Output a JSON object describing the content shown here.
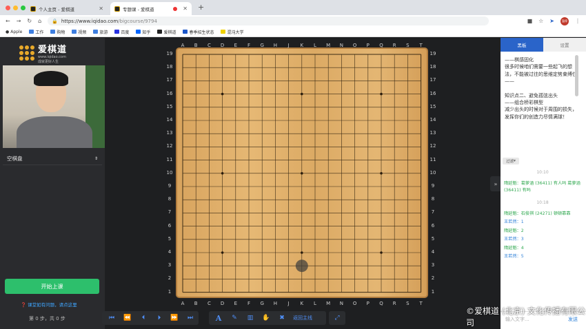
{
  "browser": {
    "tabs": [
      {
        "title": "个人主页 - 爱棋道",
        "active": false
      },
      {
        "title": "专题课 - 爱棋道",
        "active": true
      }
    ],
    "new_tab": "+",
    "url_prefix": "https://www.iqidao.com",
    "url_path": "/bigcourse/9794",
    "bookmarks": [
      "Apple",
      "工作",
      "购物",
      "视频",
      "旅游",
      "百度",
      "知乎",
      "爱棋道",
      "春季招生状态",
      "混沌大学"
    ],
    "profile_badge": "暂停"
  },
  "left": {
    "logo_title": "爱棋道",
    "logo_sub": "www.iqidao.com",
    "logo_slogan": "成就更好人生",
    "board_select": "空棋盘",
    "start_button": "开始上课",
    "help_tip": "课堂如有问题，请点这里",
    "step_info": "第 0 步，共 0 步"
  },
  "board": {
    "cols": [
      "A",
      "B",
      "C",
      "D",
      "E",
      "F",
      "G",
      "H",
      "J",
      "K",
      "L",
      "M",
      "N",
      "O",
      "P",
      "Q",
      "R",
      "S",
      "T"
    ],
    "rows": [
      "19",
      "18",
      "17",
      "16",
      "15",
      "14",
      "13",
      "12",
      "11",
      "10",
      "9",
      "8",
      "7",
      "6",
      "5",
      "4",
      "3",
      "2",
      "1"
    ],
    "star_points": [
      [
        3,
        3
      ],
      [
        9,
        3
      ],
      [
        15,
        3
      ],
      [
        3,
        9
      ],
      [
        9,
        9
      ],
      [
        15,
        9
      ],
      [
        3,
        15
      ],
      [
        9,
        15
      ],
      [
        15,
        15
      ]
    ],
    "cursor_stone": {
      "col": "K",
      "row": "3"
    }
  },
  "toolbar": {
    "nav_icons": [
      "first-icon",
      "prev5-icon",
      "prev-icon",
      "next-icon",
      "next5-icon",
      "last-icon"
    ],
    "tool_icons": [
      "text-icon",
      "pen-icon",
      "chart-icon",
      "hand-icon",
      "clear-icon"
    ],
    "back_main": "返回主线"
  },
  "right": {
    "tabs": [
      "黑板",
      "设置"
    ],
    "notes": [
      "——棋感固化",
      "很多时候咱们需要一些起飞的想法，不能被过往的思维定势束缚住——",
      "",
      "知识点二、避免孤弦出头",
      "——组合桥彩棋型",
      "减少出头的时候对于周围的损失，发挥你们的创造力尽情满球！"
    ],
    "filter": "过滤",
    "chat": [
      {
        "type": "time",
        "text": "10:10"
      },
      {
        "type": "msg",
        "color": "green",
        "text": "隋延魁：葛萝涵 (36411) 有人吗 葛萝涵 (36411) 有吗"
      },
      {
        "type": "time",
        "text": "10:18"
      },
      {
        "type": "msg",
        "color": "green",
        "text": "隋延魁：石俊祺 (24271) 顿顿靠靠"
      },
      {
        "type": "msg",
        "color": "blue",
        "text": "王若然：1"
      },
      {
        "type": "msg",
        "color": "green",
        "text": "隋延魁：2"
      },
      {
        "type": "msg",
        "color": "blue",
        "text": "王若然：3"
      },
      {
        "type": "msg",
        "color": "green",
        "text": "隋延魁：4"
      },
      {
        "type": "msg",
        "color": "blue",
        "text": "王若然：5"
      }
    ],
    "input_placeholder": "输入文字...",
    "send": "发送"
  },
  "watermark": "©爱棋道 (北京) 文化传播有限公司",
  "colors": {
    "accent": "#2dbf6c",
    "link": "#4f8ff7",
    "board": "#e2b26d"
  }
}
